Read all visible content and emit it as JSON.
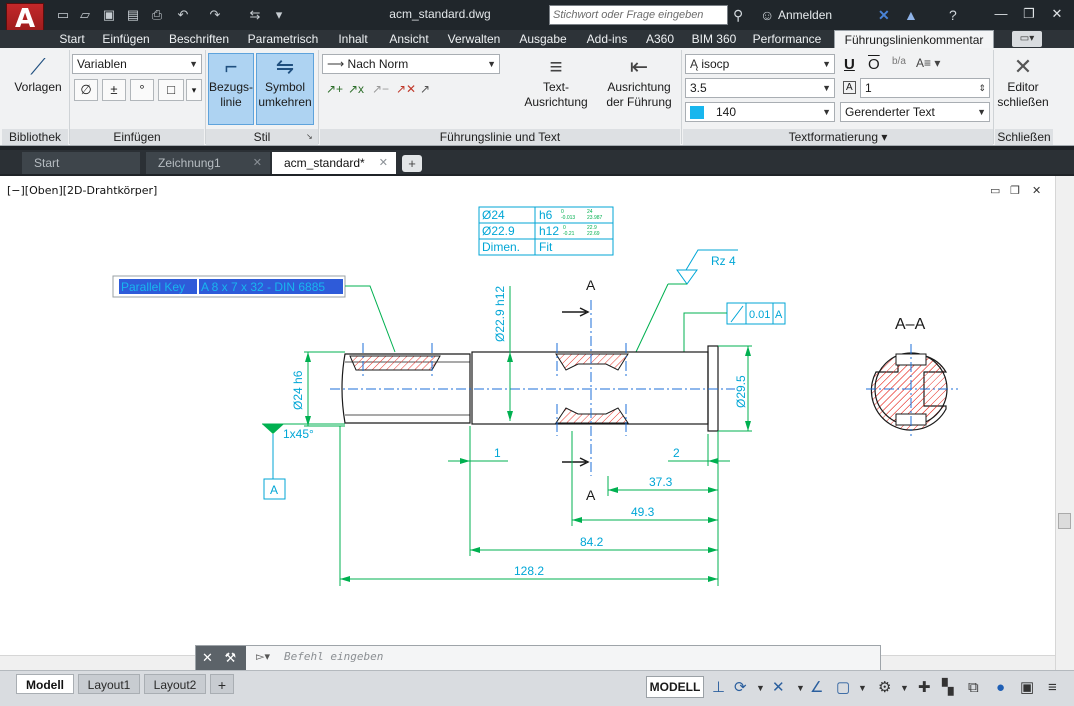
{
  "app": {
    "logo_letter": "A",
    "logo_sub": "M",
    "doc_title": "acm_standard.dwg",
    "search_placeholder": "Stichwort oder Frage eingeben",
    "login_label": "Anmelden"
  },
  "ribbon_tabs": [
    "Start",
    "Einfügen",
    "Beschriften",
    "Parametrisch",
    "Inhalt",
    "Ansicht",
    "Verwalten",
    "Ausgabe",
    "Add-ins",
    "A360",
    "BIM 360",
    "Performance",
    "Führungslinienkommentar"
  ],
  "ribbon": {
    "bibliothek": {
      "button": "Vorlagen",
      "title": "Bibliothek"
    },
    "einfuegen": {
      "combo": "Variablen",
      "symbols": [
        "∅",
        "±",
        "°",
        "□"
      ],
      "title": "Einfügen"
    },
    "stil": {
      "btn1_line1": "Bezugs-",
      "btn1_line2": "linie",
      "btn2_line1": "Symbol",
      "btn2_line2": "umkehren",
      "title": "Stil"
    },
    "fuehrung": {
      "combo": "Nach Norm",
      "btn1_line1": "Text-",
      "btn1_line2": "Ausrichtung",
      "btn2_line1": "Ausrichtung",
      "btn2_line2": "der Führung",
      "title": "Führungslinie und Text"
    },
    "textformat": {
      "font": "isocp",
      "size": "3.5",
      "color_value": "140",
      "scale_value": "1",
      "text_style": "Gerenderter Text",
      "title": "Textformatierung",
      "swatch_color": "#18b6ee"
    },
    "schliessen": {
      "btn_line1": "Editor",
      "btn_line2": "schließen",
      "title": "Schließen"
    }
  },
  "doc_tabs": [
    {
      "label": "Start",
      "active": false
    },
    {
      "label": "Zeichnung1",
      "active": false
    },
    {
      "label": "acm_standard*",
      "active": true
    }
  ],
  "viewport_label": "[−][Oben][2D-Drahtkörper]",
  "drawing": {
    "tol_table": [
      [
        "Ø24",
        "h6"
      ],
      [
        "Ø22.9",
        "h12"
      ],
      [
        "Dimen.",
        "Fit"
      ]
    ],
    "tol_h6_top": "0",
    "tol_h6_low": "-0.013",
    "tol_h6_r1": "24",
    "tol_h6_r2": "23.987",
    "tol_h12_top": "0",
    "tol_h12_low": "-0.21",
    "tol_h12_r1": "22.9",
    "tol_h12_r2": "22.69",
    "parallel_key_1": "Parallel Key",
    "parallel_key_2": "A 8 x 7 x 32 - DIN 6885",
    "roughness": "Rz 4",
    "gdt_value": "0.01",
    "gdt_datum": "A",
    "section_mark": "A",
    "section_title": "A–A",
    "dim_d22_9": "Ø22.9 h12",
    "dim_d24": "Ø24 h6",
    "dim_d29_5": "Ø29.5",
    "chamfer": "1x45°",
    "datum_box": "A",
    "dim_1": "1",
    "dim_2": "2",
    "dim_37_3": "37.3",
    "dim_49_3": "49.3",
    "dim_84_2": "84.2",
    "dim_128_2": "128.2",
    "colors": {
      "dimension": "#00b050",
      "text": "#00a6d6",
      "geometry": "#1a1a1a",
      "hatch": "#e8332a",
      "center": "#1e6fd8"
    }
  },
  "command": {
    "placeholder": "Befehl eingeben"
  },
  "layout_tabs": [
    "Modell",
    "Layout1",
    "Layout2"
  ],
  "status": {
    "model_label": "MODELL"
  }
}
